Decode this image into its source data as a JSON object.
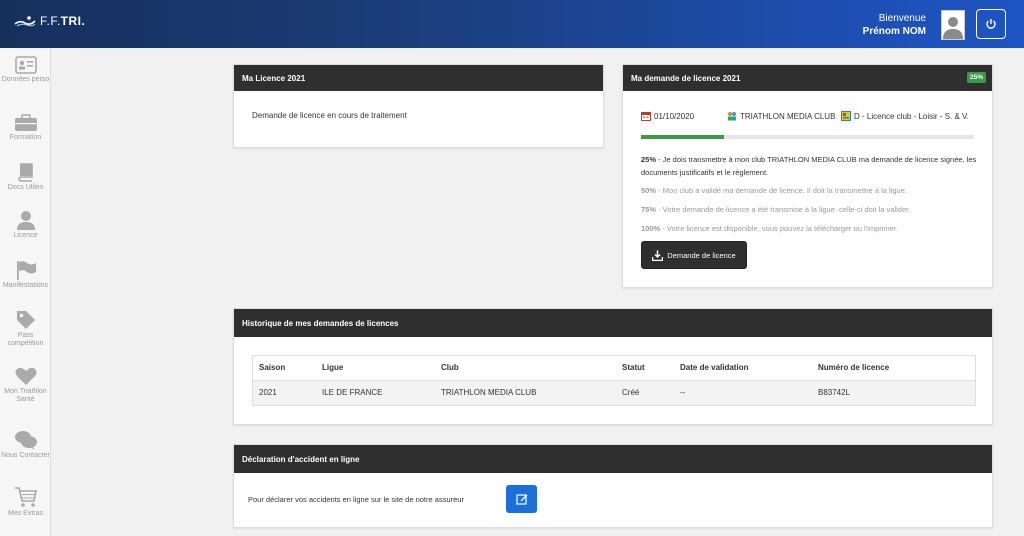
{
  "header": {
    "logo_prefix": "F.F.",
    "logo_bold": "TRI.",
    "welcome": "Bienvenue",
    "user_name": "Prénom NOM"
  },
  "sidebar": {
    "items": [
      {
        "label": "Données perso",
        "icon": "id-card-icon"
      },
      {
        "label": "Formation",
        "icon": "briefcase-icon"
      },
      {
        "label": "Docs Utiles",
        "icon": "book-icon"
      },
      {
        "label": "Licence",
        "icon": "user-icon"
      },
      {
        "label": "Manifestations",
        "icon": "flag-icon"
      },
      {
        "label": "Pass compétition",
        "icon": "tag-icon"
      },
      {
        "label": "Mon Triathlon Santé",
        "icon": "heart-icon"
      },
      {
        "label": "Nous Contacter",
        "icon": "chat-icon"
      },
      {
        "label": "Mes Extras",
        "icon": "cart-icon"
      }
    ]
  },
  "licence_panel": {
    "title": "Ma Licence 2021",
    "message": "Demande de licence en cours de traitement"
  },
  "demande_panel": {
    "title": "Ma demande de licence 2021",
    "badge": "25%",
    "progress": 0.25,
    "date": "01/10/2020",
    "club": "TRIATHLON MEDIA CLUB",
    "licence_type": "D - Licence club - Loisir - S. & V.",
    "steps": [
      {
        "pct": "25%",
        "text": " - Je dois transmettre à mon club TRIATHLON MEDIA CLUB ma demande de licence signée, les documents justificatifs et le règlement."
      },
      {
        "pct": "50%",
        "text": " - Mon club a validé ma demande de licence. Il doit la transmettre à la ligue."
      },
      {
        "pct": "75%",
        "text": " - Votre demande de licence a été transmise à la ligue. celle-ci doit la valider."
      },
      {
        "pct": "100%",
        "text": " - Votre licence est disponible, vous pouvez la télécharger ou l'imprimer."
      }
    ],
    "button": "Demande de licence"
  },
  "historique": {
    "title": "Historique de mes demandes de licences",
    "columns": [
      "Saison",
      "Ligue",
      "Club",
      "Statut",
      "Date de validation",
      "Numéro de licence"
    ],
    "rows": [
      [
        "2021",
        "ILE DE FRANCE",
        "TRIATHLON MEDIA CLUB",
        "Créé",
        "--",
        "B83742L"
      ]
    ]
  },
  "accident": {
    "title": "Déclaration d'accident en ligne",
    "text": "Pour déclarer vos accidents en ligne sur le site de notre assureur"
  },
  "colors": {
    "header_start": "#16305c",
    "header_end": "#1e55c4",
    "panel_head": "#2f2f2f",
    "progress": "#3a9a46",
    "edit_button": "#1a6fd8"
  }
}
